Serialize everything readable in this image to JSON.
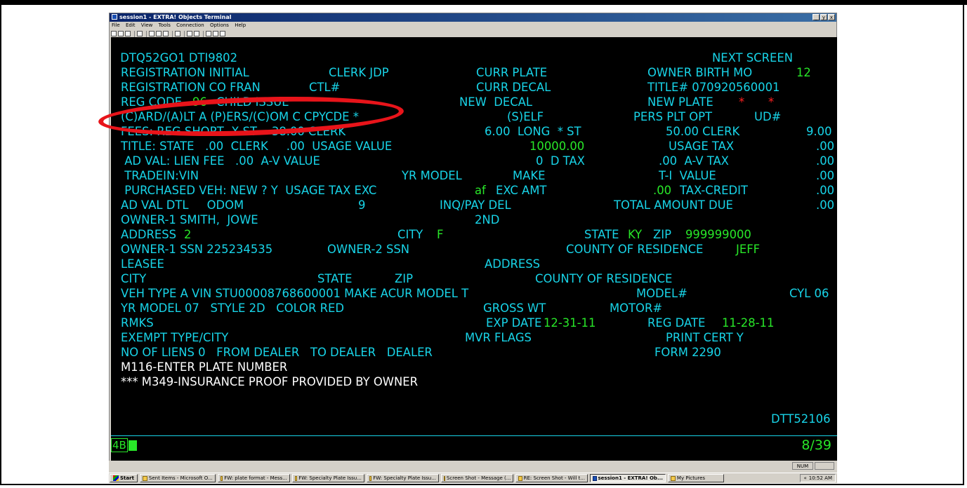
{
  "window": {
    "title": "session1 - EXTRA! Objects Terminal",
    "controls": [
      "_",
      "у",
      "x"
    ]
  },
  "menu": [
    "File",
    "Edit",
    "View",
    "Tools",
    "Connection",
    "Options",
    "Help"
  ],
  "terminal": {
    "rows": [
      [
        {
          "t": " DTQ52GO1 DTI9802",
          "c": "c"
        },
        {
          "t": "NEXT SCREEN",
          "c": "c"
        }
      ],
      [
        {
          "t": "REGISTRATION INITIAL",
          "c": "c"
        },
        {
          "t": "CLERK JDP",
          "c": "c"
        },
        {
          "t": "CURR PLATE",
          "c": "c"
        },
        {
          "t": "OWNER BIRTH MO",
          "c": "c"
        },
        {
          "t": "12",
          "c": "g"
        }
      ],
      [
        {
          "t": "REGISTRATION CO FRAN",
          "c": "c"
        },
        {
          "t": "CTL#",
          "c": "c"
        },
        {
          "t": "CURR DECAL",
          "c": "c"
        },
        {
          "t": "TITLE# 070920560001",
          "c": "c"
        }
      ],
      [
        {
          "t": "REG CODE",
          "c": "c"
        },
        {
          "t": "96",
          "c": "g"
        },
        {
          "t": "CHILD ISSUE",
          "c": "c"
        },
        {
          "t": "NEW  DECAL",
          "c": "c"
        },
        {
          "t": "NEW PLATE",
          "c": "c"
        },
        {
          "t": "*",
          "c": "r"
        },
        {
          "t": "*",
          "c": "r"
        }
      ],
      [
        {
          "t": "(C)ARD/(A)LT A (P)ERS/(C)OM C CPYCDE *",
          "c": "c"
        },
        {
          "t": "(S)ELF",
          "c": "c"
        },
        {
          "t": "PERS PLT OPT",
          "c": "c"
        },
        {
          "t": "UD#",
          "c": "c"
        }
      ],
      [
        {
          "t": "FEES: REG SHORT  X ST    38.00 CLERK",
          "c": "c"
        },
        {
          "t": "6.00  LONG  * ST",
          "c": "c"
        },
        {
          "t": "50.00 CLERK",
          "c": "c"
        },
        {
          "t": "9.00",
          "c": "c"
        }
      ],
      [
        {
          "t": "TITLE: STATE   .00  CLERK     .00  USAGE VALUE",
          "c": "c"
        },
        {
          "t": "10000.00",
          "c": "g"
        },
        {
          "t": "USAGE TAX",
          "c": "c"
        },
        {
          "t": ".00",
          "c": "c"
        }
      ],
      [
        {
          "t": " AD VAL: LIEN FEE   .00  A-V VALUE",
          "c": "c"
        },
        {
          "t": "0  D TAX",
          "c": "c"
        },
        {
          "t": ".00  A-V TAX",
          "c": "c"
        },
        {
          "t": ".00",
          "c": "c"
        }
      ],
      [
        {
          "t": " TRADEIN:VIN",
          "c": "c"
        },
        {
          "t": "YR MODEL",
          "c": "c"
        },
        {
          "t": "MAKE",
          "c": "c"
        },
        {
          "t": "T-I  VALUE",
          "c": "c"
        },
        {
          "t": ".00",
          "c": "c"
        }
      ],
      [
        {
          "t": " PURCHASED VEH: NEW ? Y  USAGE TAX EXC",
          "c": "c"
        },
        {
          "t": "af",
          "c": "g"
        },
        {
          "t": "EXC AMT",
          "c": "c"
        },
        {
          "t": ".00",
          "c": "g"
        },
        {
          "t": "TAX-CREDIT",
          "c": "c"
        },
        {
          "t": ".00",
          "c": "c"
        }
      ],
      [
        {
          "t": "AD VAL DTL     ODOM",
          "c": "c"
        },
        {
          "t": "9",
          "c": "c"
        },
        {
          "t": "INQ/PAY DEL",
          "c": "c"
        },
        {
          "t": "TOTAL AMOUNT DUE",
          "c": "c"
        },
        {
          "t": ".00",
          "c": "c"
        }
      ],
      [
        {
          "t": "OWNER-1 SMITH,  JOWE",
          "c": "c"
        },
        {
          "t": "2ND",
          "c": "c"
        }
      ],
      [
        {
          "t": "ADDRESS",
          "c": "c"
        },
        {
          "t": "2",
          "c": "g"
        },
        {
          "t": "CITY",
          "c": "c"
        },
        {
          "t": "F",
          "c": "g"
        },
        {
          "t": "STATE",
          "c": "c"
        },
        {
          "t": "KY",
          "c": "g"
        },
        {
          "t": "ZIP",
          "c": "c"
        },
        {
          "t": "999999000",
          "c": "g"
        }
      ],
      [
        {
          "t": "OWNER-1 SSN 225234535",
          "c": "c"
        },
        {
          "t": "OWNER-2 SSN",
          "c": "c"
        },
        {
          "t": "COUNTY OF RESIDENCE",
          "c": "c"
        },
        {
          "t": "JEFF",
          "c": "g"
        }
      ],
      [
        {
          "t": "LEASEE",
          "c": "c"
        },
        {
          "t": "ADDRESS",
          "c": "c"
        }
      ],
      [
        {
          "t": "CITY",
          "c": "c"
        },
        {
          "t": "STATE",
          "c": "c"
        },
        {
          "t": "ZIP",
          "c": "c"
        },
        {
          "t": "COUNTY OF RESIDENCE",
          "c": "c"
        }
      ],
      [
        {
          "t": "VEH TYPE A VIN STU00008768600001 MAKE ACUR MODEL T",
          "c": "c"
        },
        {
          "t": "MODEL#",
          "c": "c"
        },
        {
          "t": "CYL 06",
          "c": "c"
        }
      ],
      [
        {
          "t": "YR MODEL 07   STYLE 2D   COLOR RED",
          "c": "c"
        },
        {
          "t": "GROSS WT",
          "c": "c"
        },
        {
          "t": "MOTOR#",
          "c": "c"
        }
      ],
      [
        {
          "t": "RMKS",
          "c": "c"
        },
        {
          "t": "EXP DATE",
          "c": "c"
        },
        {
          "t": "12-31-11",
          "c": "g"
        },
        {
          "t": "REG DATE",
          "c": "c"
        },
        {
          "t": "11-28-11",
          "c": "g"
        }
      ],
      [
        {
          "t": "EXEMPT TYPE/CITY",
          "c": "c"
        },
        {
          "t": "MVR FLAGS",
          "c": "c"
        },
        {
          "t": "PRINT CERT Y",
          "c": "c"
        }
      ],
      [
        {
          "t": "NO OF LIENS 0   FROM DEALER   TO DEALER   DEALER",
          "c": "c"
        },
        {
          "t": "FORM 2290",
          "c": "c"
        }
      ],
      [
        {
          "t": "M116-ENTER PLATE NUMBER",
          "c": "w"
        }
      ],
      [
        {
          "t": "*** M349-INSURANCE PROOF PROVIDED BY OWNER",
          "c": "w"
        }
      ],
      [],
      [
        {
          "t": "DTT52106",
          "c": "c"
        }
      ]
    ],
    "oia_left": "4B",
    "oia_right": "8/39"
  },
  "statusbar": {
    "num": "NUM"
  },
  "taskbar": {
    "start": "Start",
    "items": [
      "Sent Items - Microsoft O...",
      "FW: plate format - Mess...",
      "FW: Specialty Plate Issu...",
      "FW: Specialty Plate Issu...",
      "Screen Shot - Message (...",
      "RE: Screen Shot - Will t...",
      "session1 - EXTRA! Ob...",
      "My Pictures"
    ],
    "active_index": 6,
    "clock": "10:52 AM"
  },
  "colors": {
    "cyan": "#18d4e8",
    "green": "#28e628",
    "red": "#ff2020",
    "annotation": "#e8141a"
  }
}
